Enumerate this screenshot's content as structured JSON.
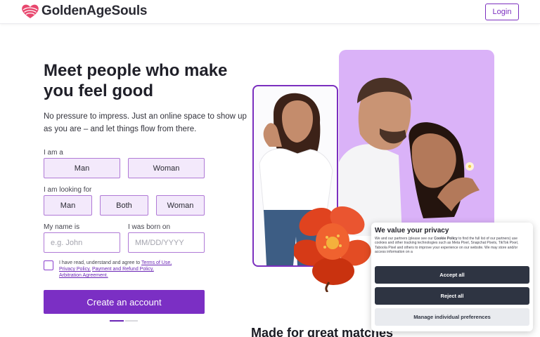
{
  "header": {
    "brand": "GoldenAgeSouls",
    "login_label": "Login"
  },
  "hero": {
    "title": "Meet people who make you feel good",
    "subtitle": "No pressure to impress. Just an online space to show up as you are – and let things flow from there."
  },
  "form": {
    "i_am_label": "I am a",
    "i_am_options": [
      "Man",
      "Woman"
    ],
    "looking_for_label": "I am looking for",
    "looking_for_options": [
      "Man",
      "Both",
      "Woman"
    ],
    "name_label": "My name is",
    "name_placeholder": "e.g. John",
    "born_label": "I was born on",
    "born_placeholder": "MM/DD/YYYY",
    "agree_prefix": "I have read, understand and agree to ",
    "agree_links": [
      "Terms of Use,",
      "Privacy Policy,",
      "Payment and Refund Policy,",
      "Arbitration Agreement."
    ],
    "submit_label": "Create an account"
  },
  "next_section": {
    "heading": "Made for great matches"
  },
  "cookie_banner": {
    "title": "We value your privacy",
    "body_prefix": "We and our partners (please see our ",
    "body_link": "Cookie Policy",
    "body_suffix": " to find the full list of our partners) use cookies and other tracking technologies such as Meta Pixel, Snapchat Pixels, TikTok Pixel, Taboola Pixel and others to improve your experience on our website. We may store and/or access information on a",
    "accept_label": "Accept all",
    "reject_label": "Reject all",
    "manage_label": "Manage individual preferences"
  },
  "colors": {
    "accent": "#7b2fc4",
    "option_bg": "#f3e9fb",
    "photo_bg": "#dab2f8",
    "cookie_button": "#2e3442"
  },
  "icons": {
    "logo": "heart-waves-logo-icon",
    "flower": "red-flower-icon"
  }
}
